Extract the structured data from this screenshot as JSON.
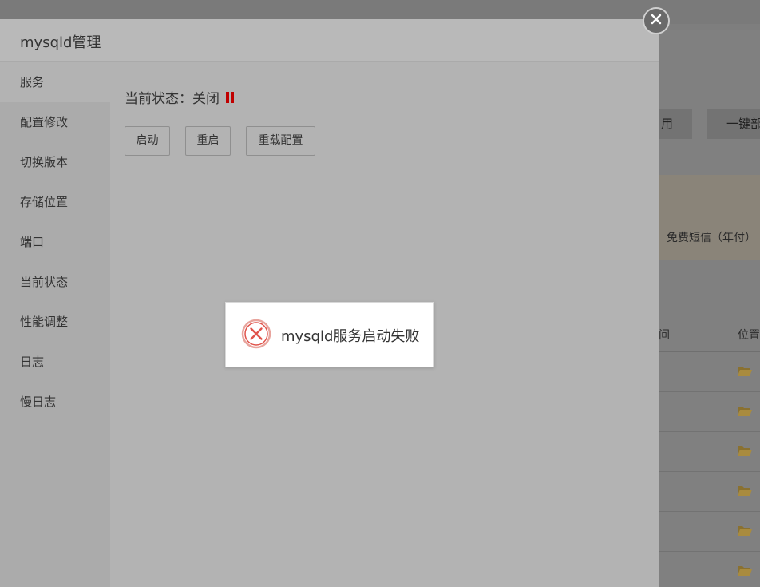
{
  "background": {
    "partial_button_1": "用",
    "partial_button_2": "一键部",
    "notice_text": "免费短信（年付）",
    "table_header": [
      "间",
      "位置"
    ],
    "folder_icon": "folder-open-icon"
  },
  "modal": {
    "title": "mysqld管理",
    "close_icon": "close-icon",
    "sidebar": {
      "items": [
        {
          "label": "服务",
          "active": true
        },
        {
          "label": "配置修改"
        },
        {
          "label": "切换版本"
        },
        {
          "label": "存储位置"
        },
        {
          "label": "端口"
        },
        {
          "label": "当前状态"
        },
        {
          "label": "性能调整"
        },
        {
          "label": "日志"
        },
        {
          "label": "慢日志"
        }
      ]
    },
    "service": {
      "status_label": "当前状态：",
      "status_value": "关闭",
      "status_icon": "pause-icon",
      "status_color": "#c00000",
      "buttons": {
        "start": "启动",
        "restart": "重启",
        "reload": "重载配置"
      }
    }
  },
  "toast": {
    "icon": "error-circle-icon",
    "icon_color": "#e0524a",
    "message": "mysqld服务启动失败"
  }
}
